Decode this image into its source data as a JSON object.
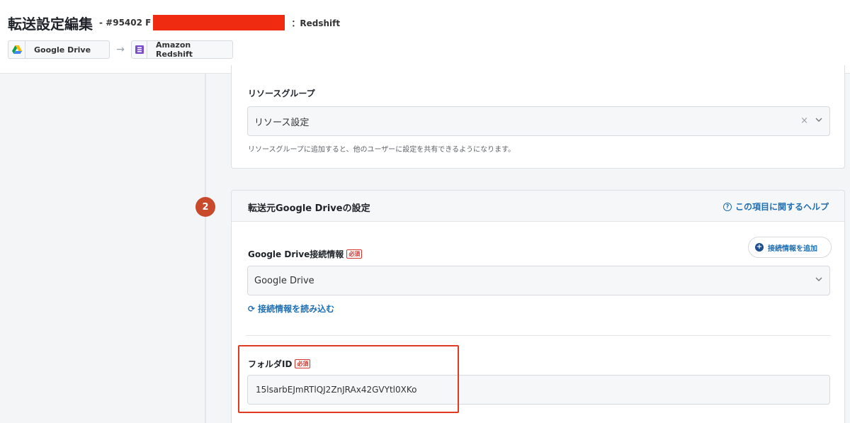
{
  "header": {
    "title": "転送設定編集",
    "id_prefix": "- #95402 F",
    "dest_suffix": "：Redshift",
    "source_chip": "Google Drive",
    "dest_chip": "Amazon Redshift",
    "arrow": "→"
  },
  "resource": {
    "label": "リソースグループ",
    "select_value": "リソース設定",
    "clear": "×",
    "hint": "リソースグループに追加すると、他のユーザーに設定を共有できるようになります。"
  },
  "step": {
    "number": "2",
    "title": "転送元Google Driveの設定",
    "help_link": "この項目に関するヘルプ",
    "help_icon": "?"
  },
  "connection": {
    "label": "Google Drive接続情報",
    "required": "必須",
    "add_button": "接続情報を追加",
    "select_value": "Google Drive",
    "reload_link": "接続情報を読み込む",
    "reload_icon": "⟳"
  },
  "folder": {
    "label": "フォルダID",
    "required": "必須",
    "value": "15lsarbEJmRTlQJ2ZnJRAx42GVYtl0XKo"
  },
  "colors": {
    "accent_blue": "#1f6fb2",
    "step_badge": "#c94a2a",
    "highlight_red": "#e23a21",
    "redaction": "#ef2b12"
  }
}
